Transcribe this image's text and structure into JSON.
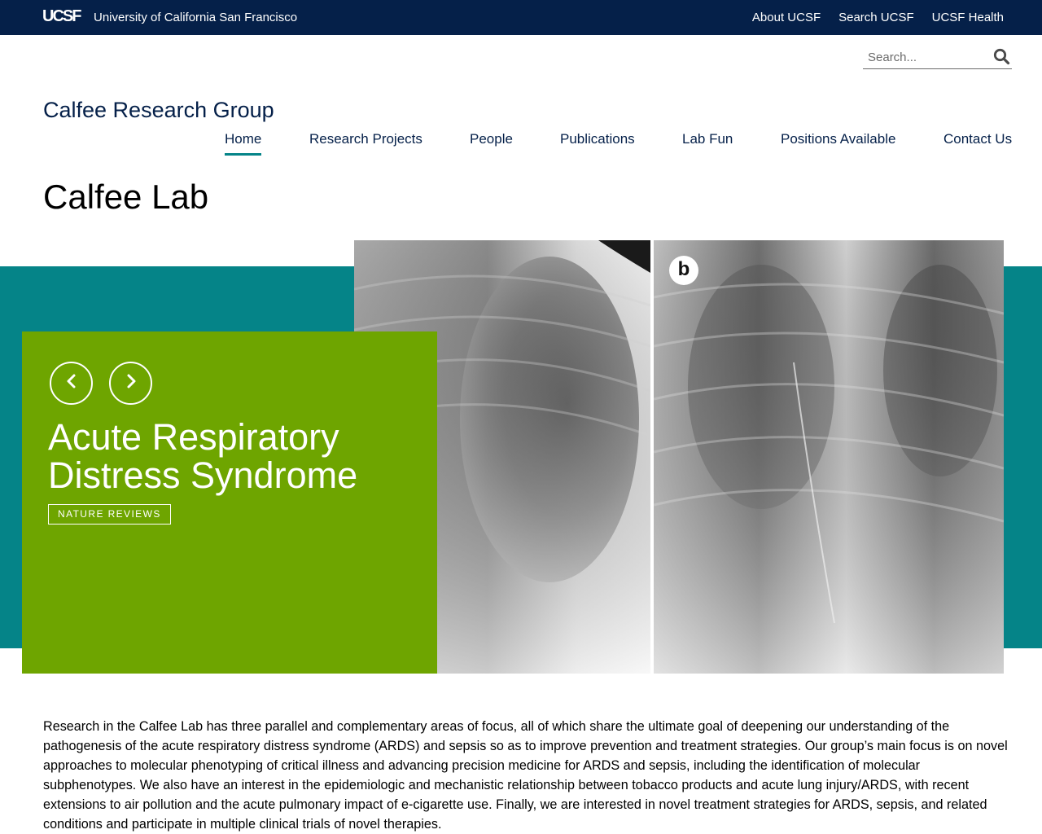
{
  "topbar": {
    "logo": "UCSF",
    "university": "University of California San Francisco",
    "links": [
      "About UCSF",
      "Search UCSF",
      "UCSF Health"
    ]
  },
  "search": {
    "placeholder": "Search...",
    "icon": "search-icon"
  },
  "site": {
    "title": "Calfee Research Group"
  },
  "nav": {
    "items": [
      "Home",
      "Research Projects",
      "People",
      "Publications",
      "Lab Fun",
      "Positions Available",
      "Contact Us"
    ],
    "active": "Home"
  },
  "page": {
    "title": "Calfee Lab"
  },
  "hero": {
    "prev_icon": "chevron-left-icon",
    "next_icon": "chevron-right-icon",
    "headline": "Acute Respiratory Distress Syndrome",
    "tag": "NATURE REVIEWS",
    "image_label": "b"
  },
  "intro": {
    "text": "Research in the Calfee Lab has three parallel and complementary areas of focus, all of which share the ultimate goal of deepening our understanding of the pathogenesis of the acute respiratory distress syndrome (ARDS) and sepsis so as to improve prevention and treatment strategies.  Our group’s main focus is on novel approaches to molecular phenotyping of critical illness and advancing precision medicine for ARDS and sepsis, including the identification of molecular subphenotypes.  We also have an interest in the epidemiologic and mechanistic relationship between tobacco products and acute lung injury/ARDS, with recent extensions to air pollution and the acute pulmonary impact of e-cigarette use.  Finally, we are interested in novel treatment strategies for ARDS, sepsis, and related conditions and participate in multiple clinical trials of novel therapies."
  },
  "colors": {
    "navy": "#052049",
    "teal": "#058488",
    "green": "#6ea500"
  }
}
